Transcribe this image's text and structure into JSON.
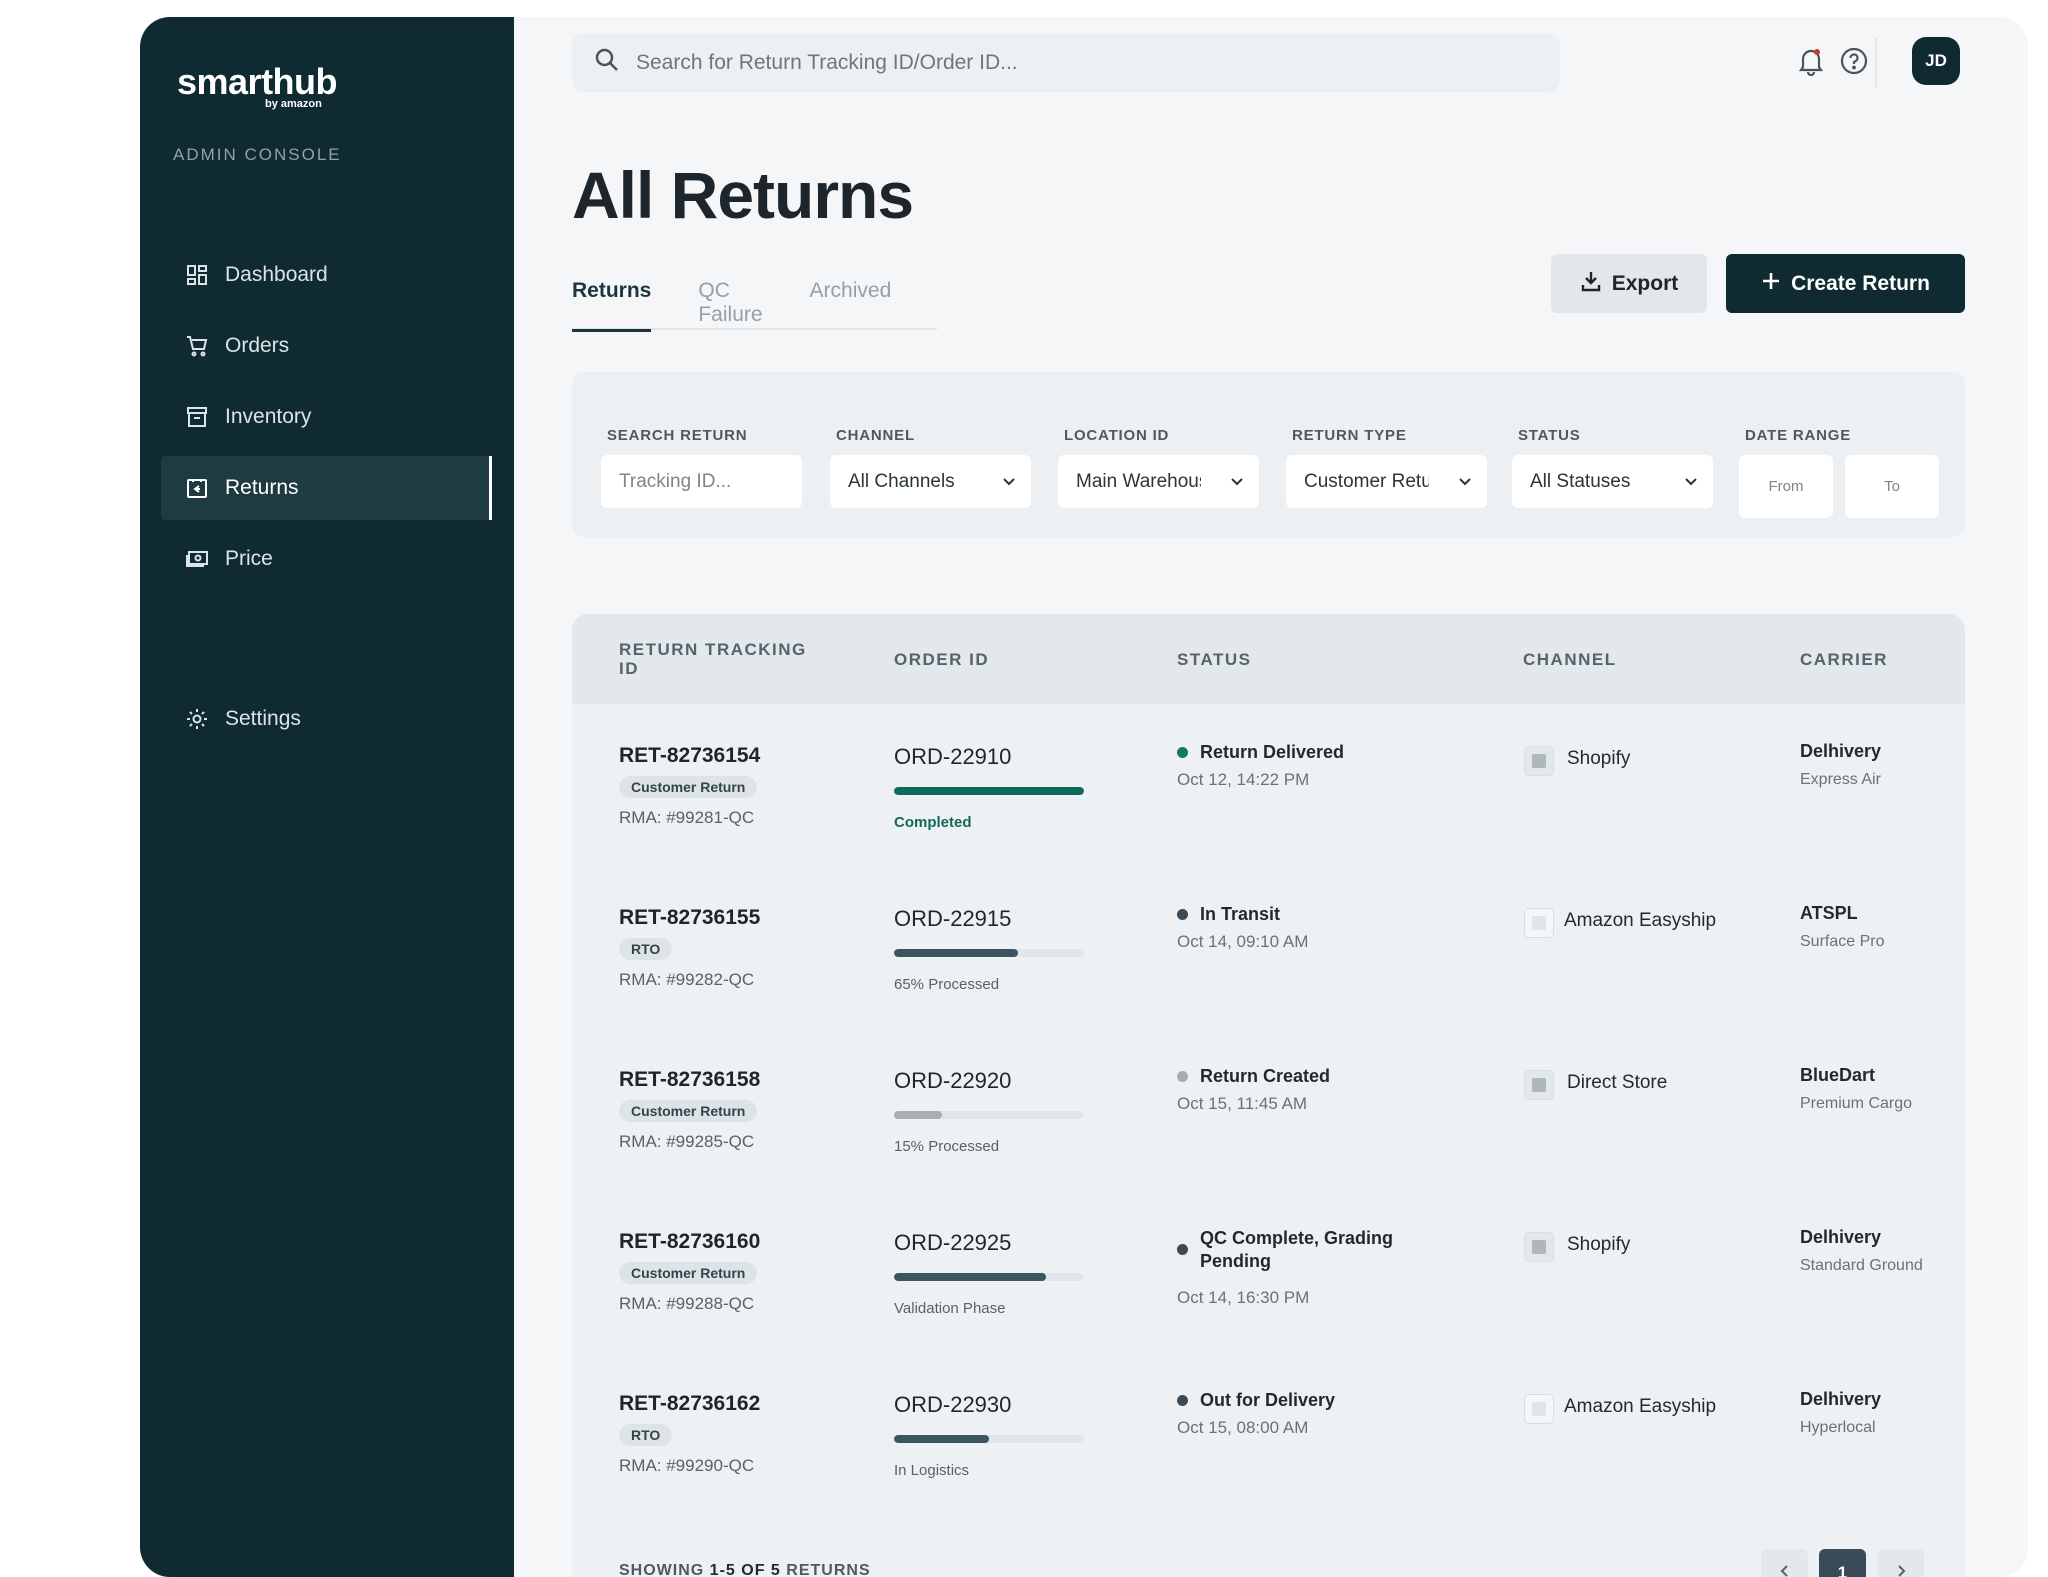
{
  "brand": {
    "name": "smarthub",
    "sub": "by amazon",
    "console_label": "ADMIN CONSOLE"
  },
  "sidebar": {
    "items": [
      {
        "label": "Dashboard",
        "icon": "dashboard-icon"
      },
      {
        "label": "Orders",
        "icon": "cart-icon"
      },
      {
        "label": "Inventory",
        "icon": "archive-box-icon"
      },
      {
        "label": "Returns",
        "icon": "return-box-icon",
        "active": true
      },
      {
        "label": "Price",
        "icon": "cash-icon"
      }
    ],
    "settings_label": "Settings"
  },
  "topbar": {
    "search_placeholder": "Search for Return Tracking ID/Order ID...",
    "avatar_initials": "JD"
  },
  "page": {
    "title": "All Returns",
    "tabs": [
      {
        "label": "Returns",
        "active": true
      },
      {
        "label": "QC Failure"
      },
      {
        "label": "Archived"
      }
    ],
    "export_label": "Export",
    "create_label": "Create Return"
  },
  "filters": {
    "search_label": "SEARCH RETURN",
    "search_placeholder": "Tracking ID...",
    "channel_label": "CHANNEL",
    "channel_value": "All Channels",
    "location_label": "LOCATION ID",
    "location_value": "Main Warehouse",
    "return_type_label": "RETURN TYPE",
    "return_type_value": "Customer Return",
    "status_label": "STATUS",
    "status_value": "All Statuses",
    "date_label": "DATE RANGE",
    "date_from": "From",
    "date_to": "To"
  },
  "table": {
    "headers": {
      "tracking_line1": "RETURN TRACKING",
      "tracking_line2": "ID",
      "order": "ORDER ID",
      "status": "STATUS",
      "channel": "CHANNEL",
      "carrier": "CARRIER"
    },
    "rows": [
      {
        "tracking_id": "RET-82736154",
        "type": "Customer Return",
        "rma": "RMA: #99281-QC",
        "order_id": "ORD-22910",
        "progress": 1.0,
        "progress_note": "Completed",
        "progress_color": "#0e6b5c",
        "note_color": "#0e6b5c",
        "status": "Return Delivered",
        "status_dot": "#127a63",
        "status_time": "Oct 12, 14:22 PM",
        "channel": "Shopify",
        "carrier": "Delhivery",
        "service": "Express Air"
      },
      {
        "tracking_id": "RET-82736155",
        "type": "RTO",
        "rma": "RMA: #99282-QC",
        "order_id": "ORD-22915",
        "progress": 0.65,
        "progress_note": "65% Processed",
        "progress_color": "#3d5461",
        "note_color": "#55636a",
        "status": "In Transit",
        "status_dot": "#3a4a56",
        "status_time": "Oct 14, 09:10 AM",
        "channel": "Amazon Easyship",
        "carrier": "ATSPL",
        "service": "Surface Pro"
      },
      {
        "tracking_id": "RET-82736158",
        "type": "Customer Return",
        "rma": "RMA: #99285-QC",
        "order_id": "ORD-22920",
        "progress": 0.25,
        "progress_note": "15% Processed",
        "progress_color": "#a6b0b4",
        "note_color": "#55636a",
        "status": "Return Created",
        "status_dot": "#a3acb0",
        "status_time": "Oct 15, 11:45 AM",
        "channel": "Direct Store",
        "carrier": "BlueDart",
        "service": "Premium Cargo"
      },
      {
        "tracking_id": "RET-82736160",
        "type": "Customer Return",
        "rma": "RMA: #99288-QC",
        "order_id": "ORD-22925",
        "progress": 0.8,
        "progress_note": "Validation Phase",
        "progress_color": "#3d5461",
        "note_color": "#55636a",
        "status": "QC Complete, Grading Pending",
        "status_dot": "#3a4a56",
        "status_time": "Oct 14, 16:30 PM",
        "channel": "Shopify",
        "carrier": "Delhivery",
        "service": "Standard Ground"
      },
      {
        "tracking_id": "RET-82736162",
        "type": "RTO",
        "rma": "RMA: #99290-QC",
        "order_id": "ORD-22930",
        "progress": 0.5,
        "progress_note": "In Logistics",
        "progress_color": "#3d5461",
        "note_color": "#55636a",
        "status": "Out for Delivery",
        "status_dot": "#3a4a56",
        "status_time": "Oct 15, 08:00 AM",
        "channel": "Amazon Easyship",
        "carrier": "Delhivery",
        "service": "Hyperlocal"
      }
    ]
  },
  "pagination": {
    "prefix": "SHOWING",
    "range": "1-5",
    "of": "OF",
    "total": "5",
    "suffix": "RETURNS",
    "current_page": "1"
  }
}
